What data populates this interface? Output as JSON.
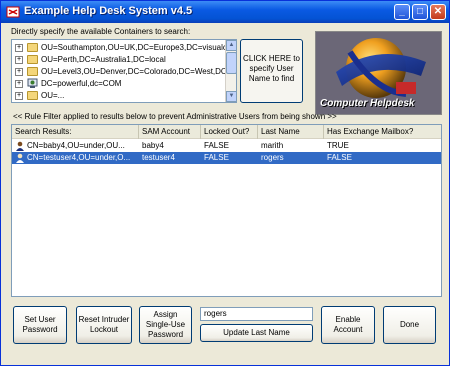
{
  "window": {
    "title": "Example Help Desk System v4.5",
    "minimize_glyph": "_",
    "maximize_glyph": "□",
    "close_glyph": "✕"
  },
  "containers": {
    "label": "Directly specify the available Containers to search:",
    "items": [
      {
        "text": "OU=Southampton,OU=UK,DC=Europe3,DC=visualclick",
        "icon": "folder-icon"
      },
      {
        "text": "OU=Perth,DC=Australia1,DC=local",
        "icon": "folder-icon"
      },
      {
        "text": "OU=Level3,OU=Denver,DC=Colorado,DC=West,DC=lo",
        "icon": "folder-icon"
      },
      {
        "text": "DC=powerful,dc=COM",
        "icon": "domain-icon"
      },
      {
        "text": "OU=...",
        "icon": "folder-icon"
      }
    ],
    "expand_glyph": "+",
    "click_here_label": "CLICK HERE to specify User Name to find"
  },
  "logo": {
    "text": "Computer Helpdesk"
  },
  "notice": "<< Rule Filter applied to results below to prevent Administrative Users from being shown >>",
  "results": {
    "columns": [
      "Search Results:",
      "SAM Account",
      "Locked Out?",
      "Last Name",
      "Has Exchange Mailbox?"
    ],
    "rows": [
      {
        "dn": "CN=baby4,OU=under,OU...",
        "sam": "baby4",
        "locked": "FALSE",
        "last": "marith",
        "mailbox": "TRUE",
        "selected": false
      },
      {
        "dn": "CN=testuser4,OU=under,O...",
        "sam": "testuser4",
        "locked": "FALSE",
        "last": "rogers",
        "mailbox": "FALSE",
        "selected": true
      }
    ]
  },
  "actions": {
    "set_password": "Set User Password",
    "reset_lockout": "Reset Intruder Lockout",
    "assign_password": "Assign Single-Use Password",
    "last_name_value": "rogers",
    "update_last_name": "Update Last Name",
    "enable_account": "Enable Account",
    "done": "Done"
  }
}
